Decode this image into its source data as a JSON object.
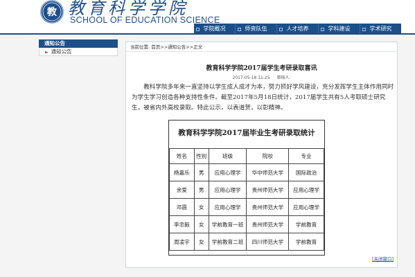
{
  "header": {
    "logo_glyph": "教",
    "title_cn": "教育科学学院",
    "title_en": "SCHOOL OF EDUCATION SCIENCE"
  },
  "nav": {
    "items": [
      {
        "label": "学院概况"
      },
      {
        "label": "师资队伍"
      },
      {
        "label": "人才培养"
      },
      {
        "label": "学科建设"
      },
      {
        "label": "学术研究"
      }
    ]
  },
  "sidebar": {
    "title": "通知公告",
    "items": [
      {
        "label": "通知公告",
        "bullet": "►"
      }
    ]
  },
  "breadcrumb": {
    "prefix": "当前位置:",
    "home": "首页",
    "sep1": ">>",
    "section": "通知公告",
    "sep2": ">>",
    "current": "正文"
  },
  "article": {
    "title": "教育科学学院2017届学生考研录取喜讯",
    "date": "2017-05-18 11:25",
    "reviewer_label": "审核人:",
    "paragraph1": "　　教科学院多年来一直坚持以学生成人成才为本，努力抓好学风建设，充分发挥学生主体作用同时为学生学习创造各种支持性条件。截至2017年5月18日统计，2017届学生共有5人考取硕士研究生，被省内外高校录取。特此公示，以表道贺，以彰精神。",
    "table": {
      "title": "教育科学学院2017届毕业生考研录取统计",
      "headers": [
        "姓名",
        "性别",
        "班级",
        "院校",
        "专业"
      ],
      "rows": [
        [
          "杨嘉乐",
          "男",
          "应用心理学",
          "华中师范大学",
          "国际政治"
        ],
        [
          "余爱",
          "男",
          "应用心理学",
          "贵州师范大学",
          "应用心理学"
        ],
        [
          "邓霞",
          "女",
          "应用心理学",
          "贵州师范大学",
          "应用心理学"
        ],
        [
          "李忠毅",
          "女",
          "学前教育一班",
          "贵州师范大学",
          "学前教育"
        ],
        [
          "周凌宇",
          "女",
          "学前教育二班",
          "四川师范大学",
          "学前教育"
        ]
      ]
    },
    "close_label": "关闭窗口",
    "close_open": "[",
    "close_close": "]"
  },
  "colors": {
    "brand": "#1a4f8a",
    "link": "#1a4fa0",
    "bullet": "#c02020"
  }
}
